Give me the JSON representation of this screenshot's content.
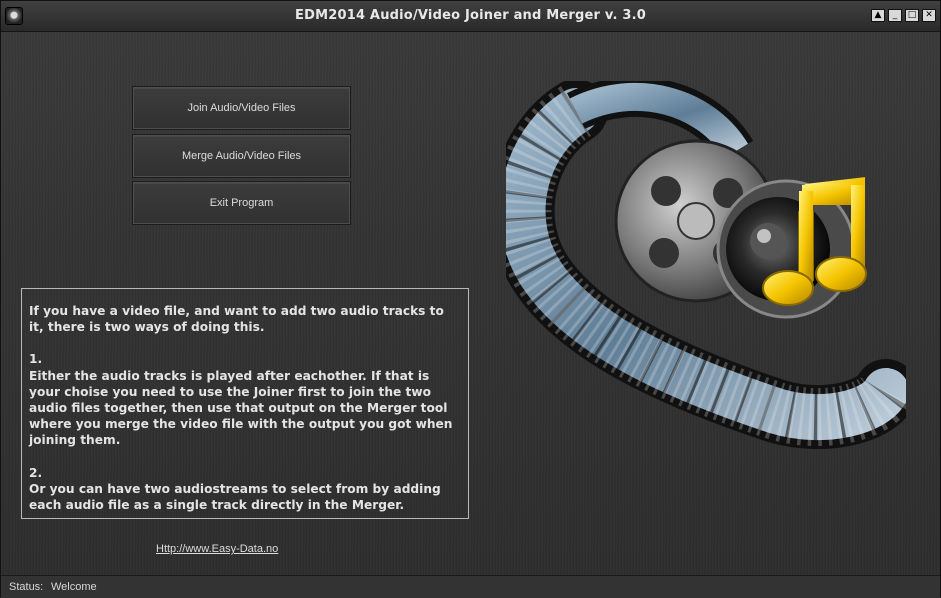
{
  "window": {
    "title": "EDM2014 Audio/Video Joiner and Merger v. 3.0",
    "controls": {
      "help": "▲",
      "minimize": "_",
      "maximize": "□",
      "close": "✕"
    }
  },
  "buttons": {
    "join": "Join Audio/Video Files",
    "merge": "Merge Audio/Video Files",
    "exit": "Exit Program"
  },
  "info": {
    "p1": "If you have a video file, and want to add two audio tracks to it, there is two ways of doing this.",
    "p2_num": "1.",
    "p2": "Either the audio tracks is played after eachother. If that is your choise you need to use the Joiner first to join the two audio files together, then use that output on the Merger tool where you merge the video file with the output you got when joining them.",
    "p3_num": "2.",
    "p3": "Or you can have two audiostreams to select from by adding each audio file as a single track directly in the Merger."
  },
  "link": "Http://www.Easy-Data.no",
  "status": {
    "label": "Status:",
    "text": "Welcome"
  },
  "colors": {
    "note": "#f5c400",
    "film": "#6f8fa8",
    "background": "#2f2f2f"
  },
  "icons": [
    "app-icon",
    "film-reel-icon",
    "speaker-icon",
    "music-note-icon"
  ]
}
